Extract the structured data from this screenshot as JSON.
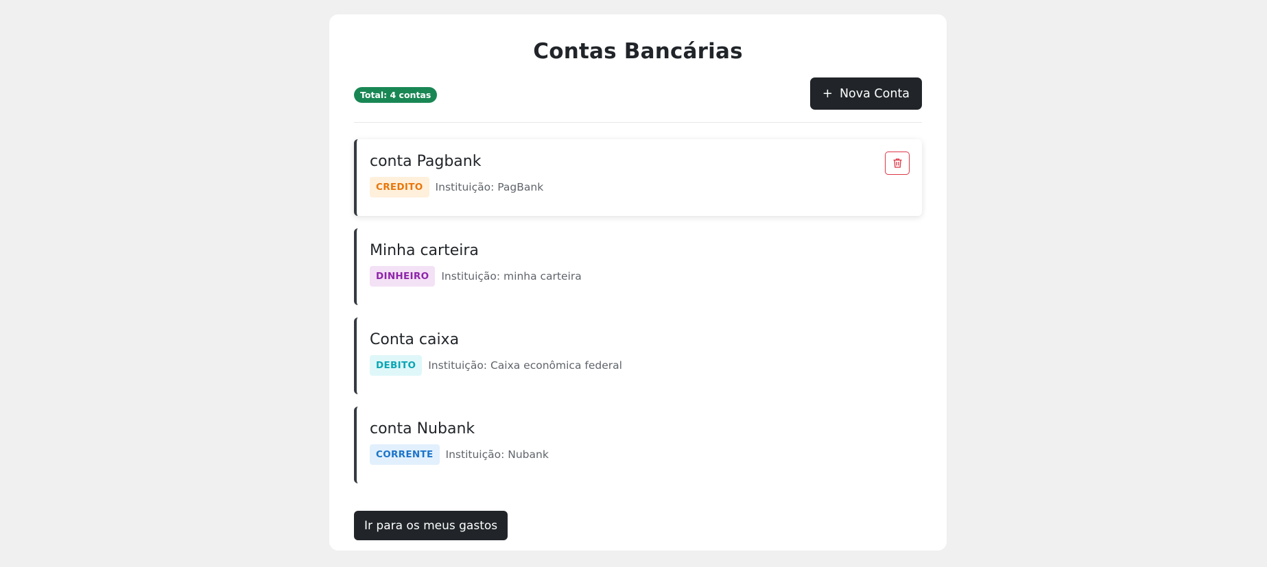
{
  "page": {
    "title": "Contas Bancárias",
    "total_badge": "Total: 4 contas",
    "new_account_label": "Nova Conta",
    "new_account_icon": "plus-icon",
    "goto_expenses_label": "Ir para os meus gastos"
  },
  "accounts": [
    {
      "name": "conta Pagbank",
      "type": "CREDITO",
      "institution": "Instituição: PagBank",
      "badge_bg": "#fff0dc",
      "badge_color": "#e8760a",
      "has_delete": true,
      "delete_icon": "trash-icon"
    },
    {
      "name": "Minha carteira",
      "type": "DINHEIRO",
      "institution": "Instituição: minha carteira",
      "badge_bg": "#f3e1f5",
      "badge_color": "#8e24aa"
    },
    {
      "name": "Conta caixa",
      "type": "DEBITO",
      "institution": "Instituição: Caixa econômica federal",
      "badge_bg": "#dff7f9",
      "badge_color": "#0aa5b4"
    },
    {
      "name": "conta Nubank",
      "type": "CORRENTE",
      "institution": "Instituição: Nubank",
      "badge_bg": "#e2f0fd",
      "badge_color": "#1c74c9"
    }
  ],
  "colors": {
    "background": "#eff0ef",
    "primary_dark": "#212529",
    "success": "#198754",
    "danger": "#dc3545"
  }
}
